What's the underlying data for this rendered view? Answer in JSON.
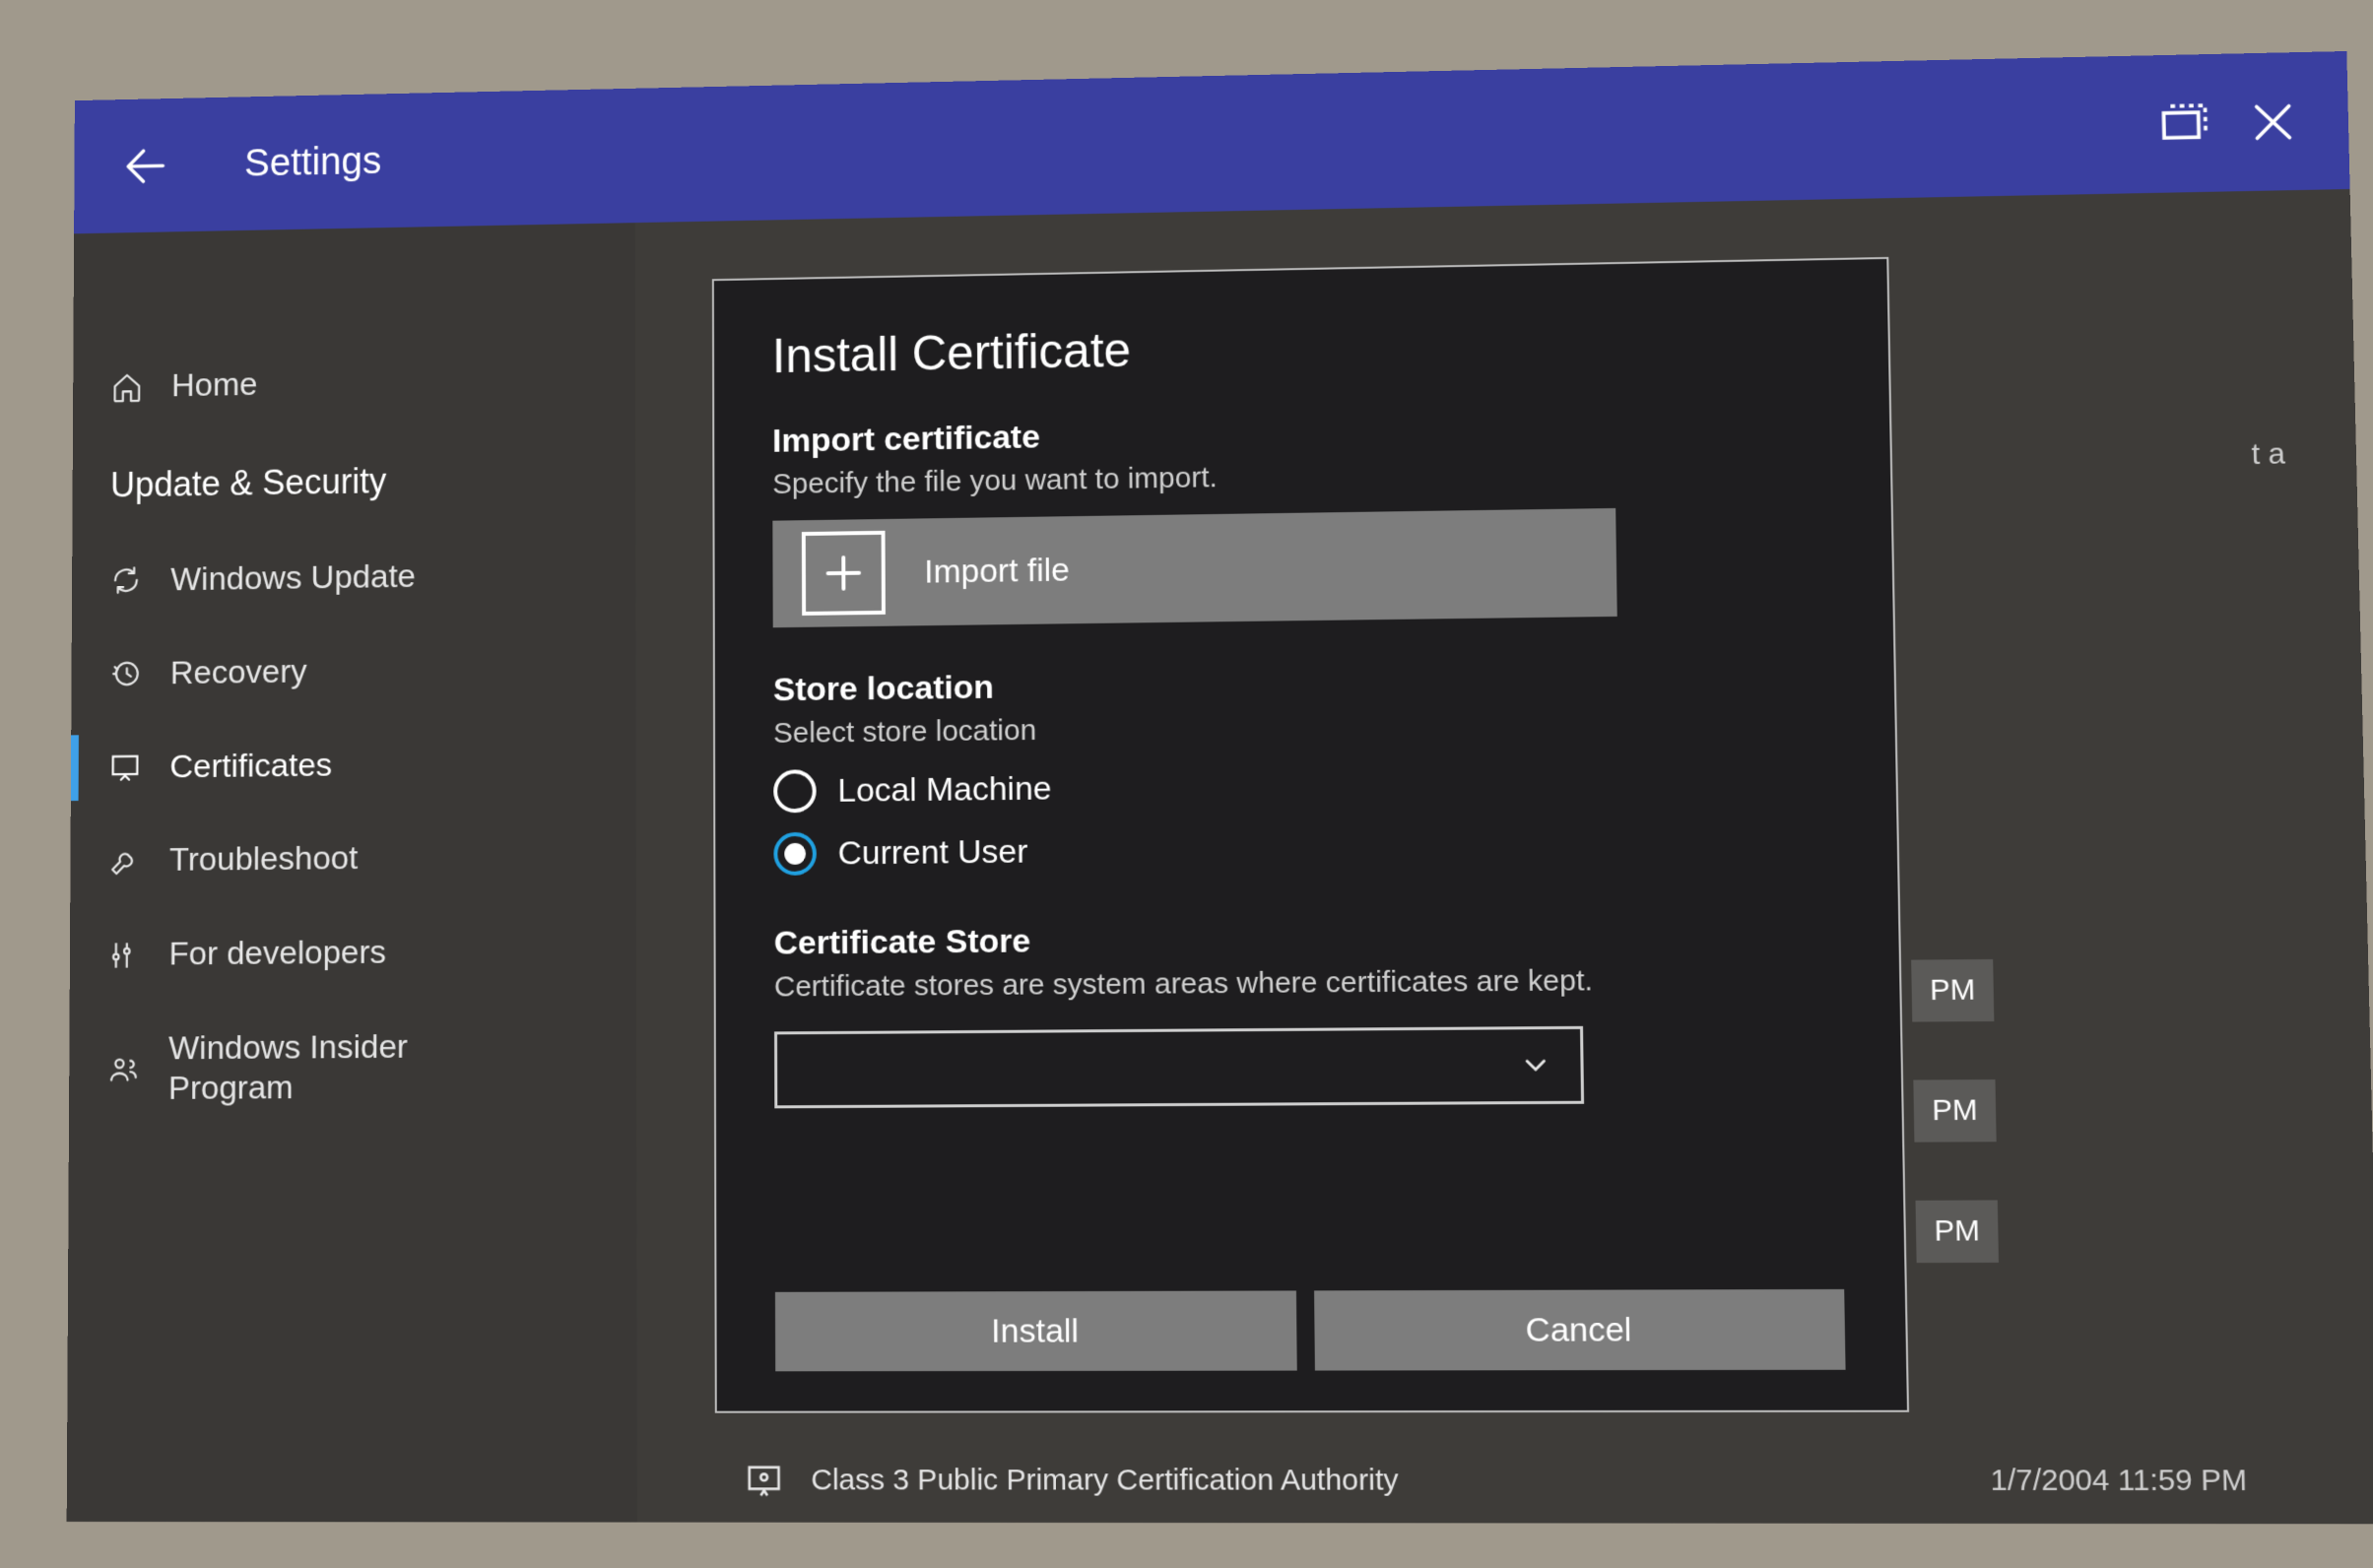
{
  "titlebar": {
    "title": "Settings"
  },
  "sidebar": {
    "home": "Home",
    "section": "Update & Security",
    "items": [
      {
        "label": "Windows Update"
      },
      {
        "label": "Recovery"
      },
      {
        "label": "Certificates"
      },
      {
        "label": "Troubleshoot"
      },
      {
        "label": "For developers"
      },
      {
        "label": "Windows Insider Program"
      }
    ]
  },
  "dialog": {
    "title": "Install Certificate",
    "import": {
      "title": "Import certificate",
      "sub": "Specify the file you want to import.",
      "button": "Import file"
    },
    "store_location": {
      "title": "Store location",
      "sub": "Select store location",
      "options": {
        "local": "Local Machine",
        "current": "Current User"
      },
      "selected": "current"
    },
    "cert_store": {
      "title": "Certificate Store",
      "sub": "Certificate stores are system areas where certificates are kept.",
      "value": ""
    },
    "buttons": {
      "install": "Install",
      "cancel": "Cancel"
    }
  },
  "background": {
    "fragment_top": "t a",
    "pm1": "PM",
    "pm2": "PM",
    "pm3": "PM",
    "row_name": "Class 3 Public Primary Certification Authority",
    "row_date": "1/7/2004 11:59 PM"
  }
}
